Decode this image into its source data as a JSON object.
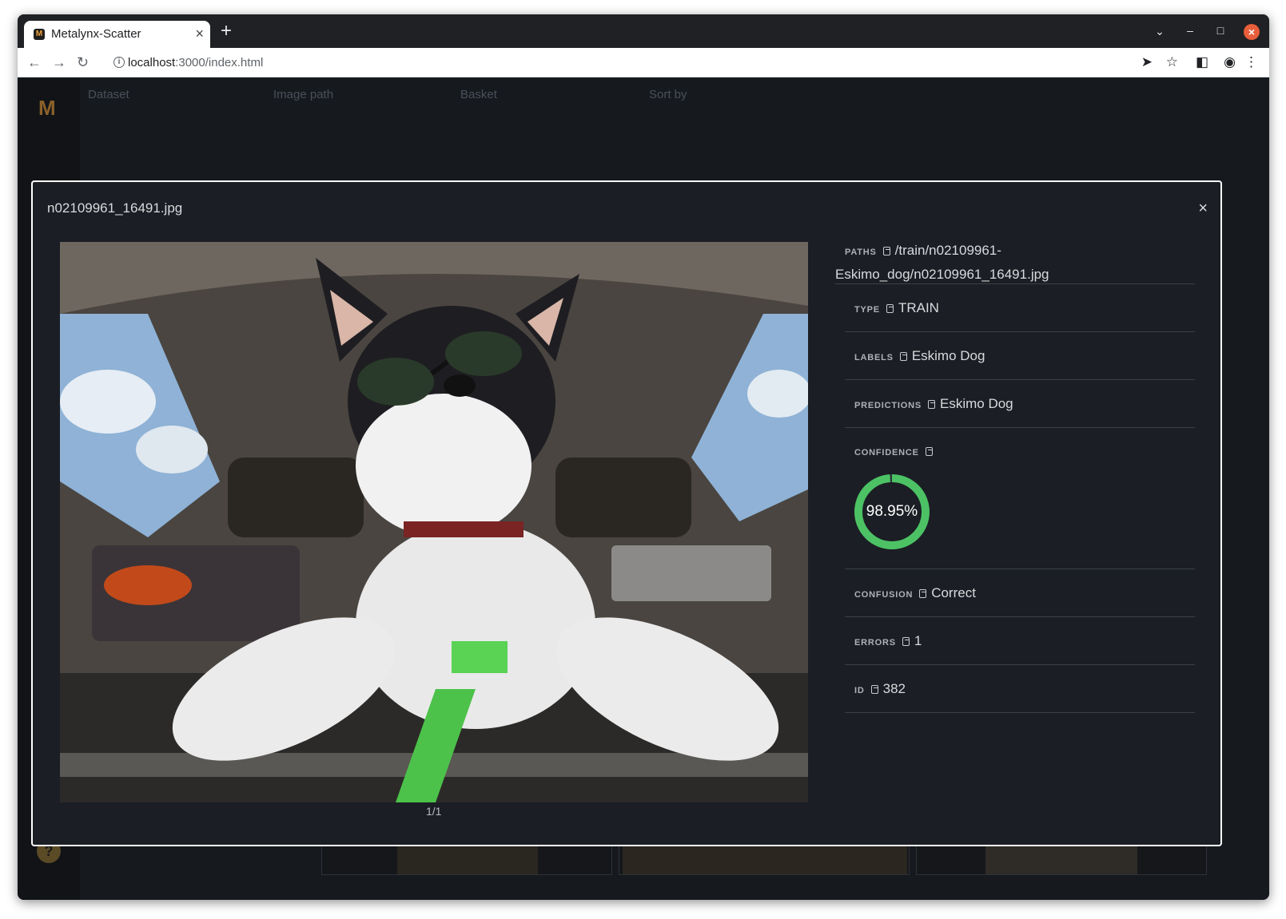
{
  "browser": {
    "tab_title": "Metalynx-Scatter",
    "tab_favicon": "M",
    "url_host": "localhost",
    "url_rest": ":3000/index.html"
  },
  "app": {
    "logo": "M",
    "nav": [
      "Dataset",
      "Image path",
      "Basket",
      "Sort by"
    ],
    "help": "?"
  },
  "modal": {
    "title": "n02109961_16491.jpg",
    "close": "×",
    "pager": "1/1",
    "fields": {
      "paths": {
        "label": "PATHS",
        "value_line1": "/train/n02109961-",
        "value_line2": "Eskimo_dog/n02109961_16491.jpg"
      },
      "type": {
        "label": "TYPE",
        "value": "TRAIN"
      },
      "labels": {
        "label": "LABELS",
        "value": "Eskimo Dog"
      },
      "predictions": {
        "label": "PREDICTIONS",
        "value": "Eskimo Dog"
      },
      "confidence": {
        "label": "CONFIDENCE",
        "value_text": "98.95%",
        "value": 0.9895,
        "color": "#4cc265"
      },
      "confusion": {
        "label": "CONFUSION",
        "value": "Correct"
      },
      "errors": {
        "label": "ERRORS",
        "value": "1"
      },
      "id": {
        "label": "ID",
        "value": "382"
      }
    }
  }
}
